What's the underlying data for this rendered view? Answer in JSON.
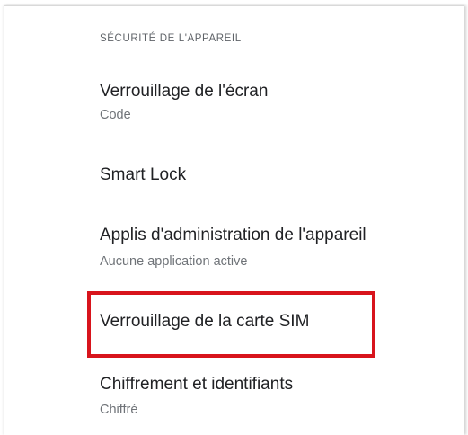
{
  "section": {
    "header": "SÉCURITÉ DE L'APPAREIL"
  },
  "items": [
    {
      "title": "Verrouillage de l'écran",
      "summary": "Code"
    },
    {
      "title": "Smart Lock"
    },
    {
      "title": "Applis d'administration de l'appareil",
      "summary": "Aucune application active"
    },
    {
      "title": "Verrouillage de la carte SIM"
    },
    {
      "title": "Chiffrement et identifiants",
      "summary": "Chiffré"
    }
  ],
  "highlight": {
    "color": "#d8141c",
    "target": "Verrouillage de la carte SIM"
  },
  "colors": {
    "title_text": "#202124",
    "summary_text": "#6f7378",
    "header_text": "#5f6368"
  }
}
